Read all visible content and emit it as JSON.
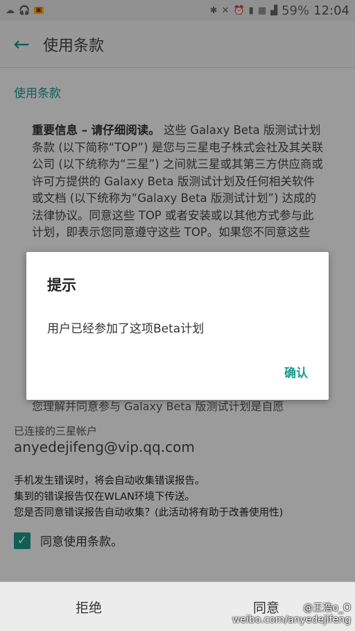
{
  "status_bar": {
    "battery": "59%",
    "time": "12:04"
  },
  "app_bar": {
    "title": "使用条款"
  },
  "content": {
    "section_title": "使用条款",
    "terms_bold": "重要信息 – 请仔细阅读。",
    "terms_text": " 这些 Galaxy Beta 版测试计划条款 (以下简称“TOP”) 是您与三星电子株式会社及其关联公司 (以下统称为“三星”) 之间就三星或其第三方供应商或许可方提供的 Galaxy Beta 版测试计划及任何相关软件或文档 (以下统称为“Galaxy Beta 版测试计划”) 达成的法律协议。同意这些 TOP 或者安装或以其他方式参与此计划，即表示您同意遵守这些 TOP。如果您不同意这些",
    "terms_faded": "您理解并同意参与 Galaxy Beta 版测试计划是自愿",
    "account_label": "已连接的三星帐户",
    "account_email": "anyedejifeng@vip.qq.com",
    "error_report_lines": [
      "手机发生错误时，将会自动收集错误报告。",
      "集到的错误报告仅在WLAN环境下传送。",
      "您是否同意错误报告自动收集？(此活动将有助于改善使用性)"
    ],
    "agree_label": "同意使用条款。"
  },
  "bottom_bar": {
    "reject_label": "拒绝",
    "accept_label": "同意"
  },
  "dialog": {
    "title": "提示",
    "message": "用户已经参加了这项Beta计划",
    "confirm_label": "确认"
  },
  "watermark": {
    "line1": "@王浩o_O",
    "line2": "weibo.com/anyedejifeng"
  },
  "colors": {
    "accent": "#1a9a8d"
  }
}
